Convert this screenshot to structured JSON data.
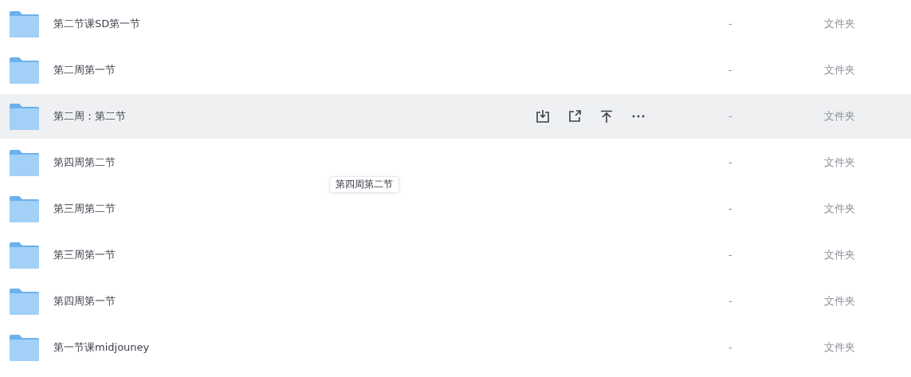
{
  "files": [
    {
      "name": "第二节课SD第一节",
      "size": "-",
      "type": "文件夹",
      "hovered": false
    },
    {
      "name": "第二周第一节",
      "size": "-",
      "type": "文件夹",
      "hovered": false
    },
    {
      "name": "第二周：第二节",
      "size": "-",
      "type": "文件夹",
      "hovered": true
    },
    {
      "name": "第四周第二节",
      "size": "-",
      "type": "文件夹",
      "hovered": false
    },
    {
      "name": "第三周第二节",
      "size": "-",
      "type": "文件夹",
      "hovered": false
    },
    {
      "name": "第三周第一节",
      "size": "-",
      "type": "文件夹",
      "hovered": false
    },
    {
      "name": "第四周第一节",
      "size": "-",
      "type": "文件夹",
      "hovered": false
    },
    {
      "name": "第一节课midjouney",
      "size": "-",
      "type": "文件夹",
      "hovered": false
    }
  ],
  "tooltip": {
    "text": "第四周第二节"
  }
}
